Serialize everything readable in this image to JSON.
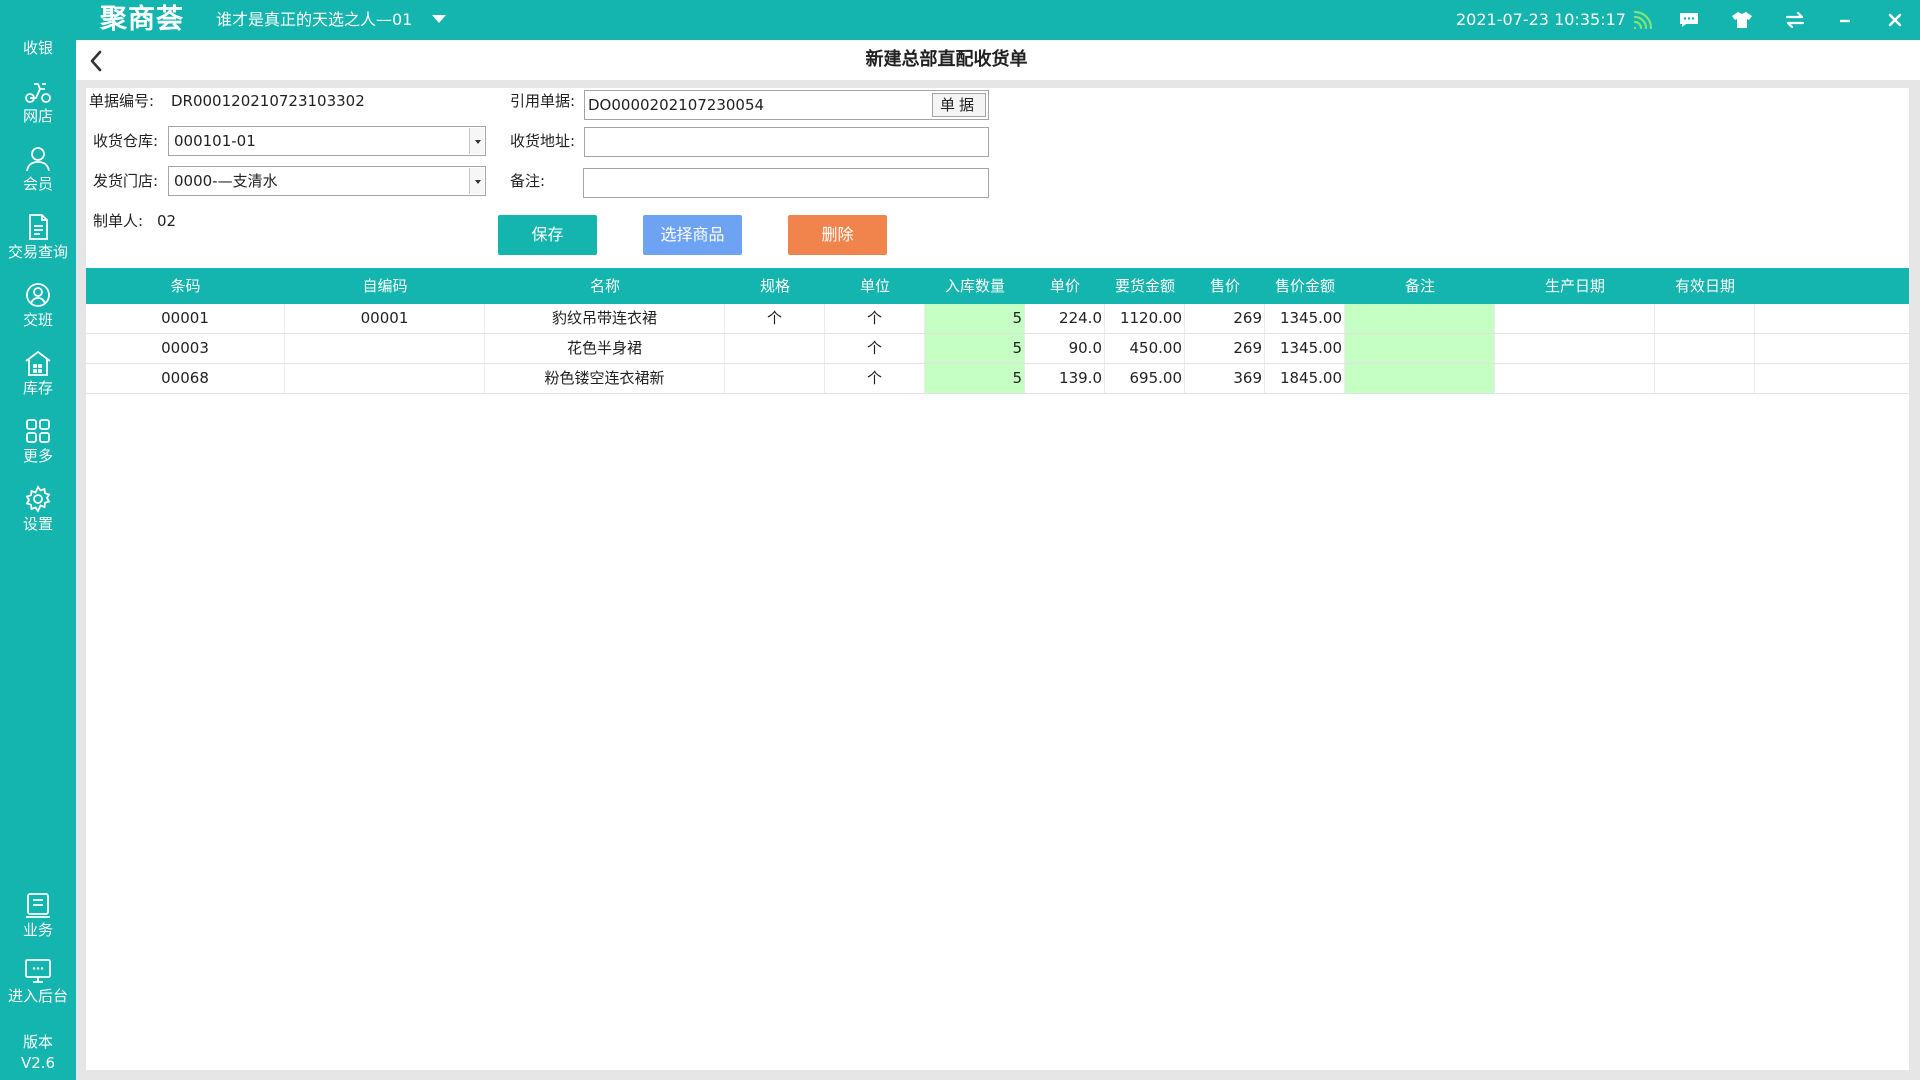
{
  "topbar": {
    "logo": "聚商荟",
    "store_name": "谁才是真正的天选之人—01",
    "datetime": "2021-07-23 10:35:17",
    "icons": [
      "wifi-signal-icon",
      "chat-icon",
      "shirt-icon",
      "sync-icon",
      "minimize-icon",
      "close-icon"
    ]
  },
  "sidebar": {
    "items": [
      {
        "label": "收银",
        "icon": "cashier-icon"
      },
      {
        "label": "网店",
        "icon": "online-shop-icon"
      },
      {
        "label": "会员",
        "icon": "member-icon"
      },
      {
        "label": "交易查询",
        "icon": "transaction-query-icon"
      },
      {
        "label": "交班",
        "icon": "shift-handover-icon"
      },
      {
        "label": "库存",
        "icon": "inventory-icon"
      },
      {
        "label": "更多",
        "icon": "more-icon"
      },
      {
        "label": "设置",
        "icon": "settings-icon"
      },
      {
        "label": "业务",
        "icon": "business-icon"
      },
      {
        "label": "进入后台",
        "icon": "backend-icon"
      }
    ],
    "version_label": "版本",
    "version": "V2.6"
  },
  "page": {
    "title": "新建总部直配收货单"
  },
  "form": {
    "doc_no_label": "单据编号:",
    "doc_no": "DR000120210723103302",
    "ref_label": "引用单据:",
    "ref_value": "DO0000202107230054",
    "ref_button": "单据",
    "warehouse_label": "收货仓库:",
    "warehouse_value": "000101-01",
    "address_label": "收货地址:",
    "address_value": "",
    "store_label": "发货门店:",
    "store_value": "0000-—支清水",
    "remark_label": "备注:",
    "remark_value": "",
    "maker_label": "制单人:",
    "maker_value": "02"
  },
  "actions": {
    "save": "保存",
    "select_goods": "选择商品",
    "delete": "删除"
  },
  "table": {
    "columns": [
      "条码",
      "自编码",
      "名称",
      "规格",
      "单位",
      "入库数量",
      "单价",
      "要货金额",
      "售价",
      "售价金额",
      "备注",
      "生产日期",
      "有效日期"
    ],
    "rows": [
      [
        "00001",
        "00001",
        "豹纹吊带连衣裙",
        "个",
        "个",
        "5",
        "224.0",
        "1120.00",
        "269",
        "1345.00",
        "",
        "",
        ""
      ],
      [
        "00003",
        "",
        "花色半身裙",
        "",
        "个",
        "5",
        "90.0",
        "450.00",
        "269",
        "1345.00",
        "",
        "",
        ""
      ],
      [
        "00068",
        "",
        "粉色镂空连衣裙新",
        "",
        "个",
        "5",
        "139.0",
        "695.00",
        "369",
        "1845.00",
        "",
        "",
        ""
      ]
    ]
  },
  "colors": {
    "brand": "#13b5ae",
    "save_button": "#13b5ae",
    "select_button": "#6ea3f4",
    "delete_button": "#f0844c",
    "editable_cell": "#c5ffc3"
  }
}
